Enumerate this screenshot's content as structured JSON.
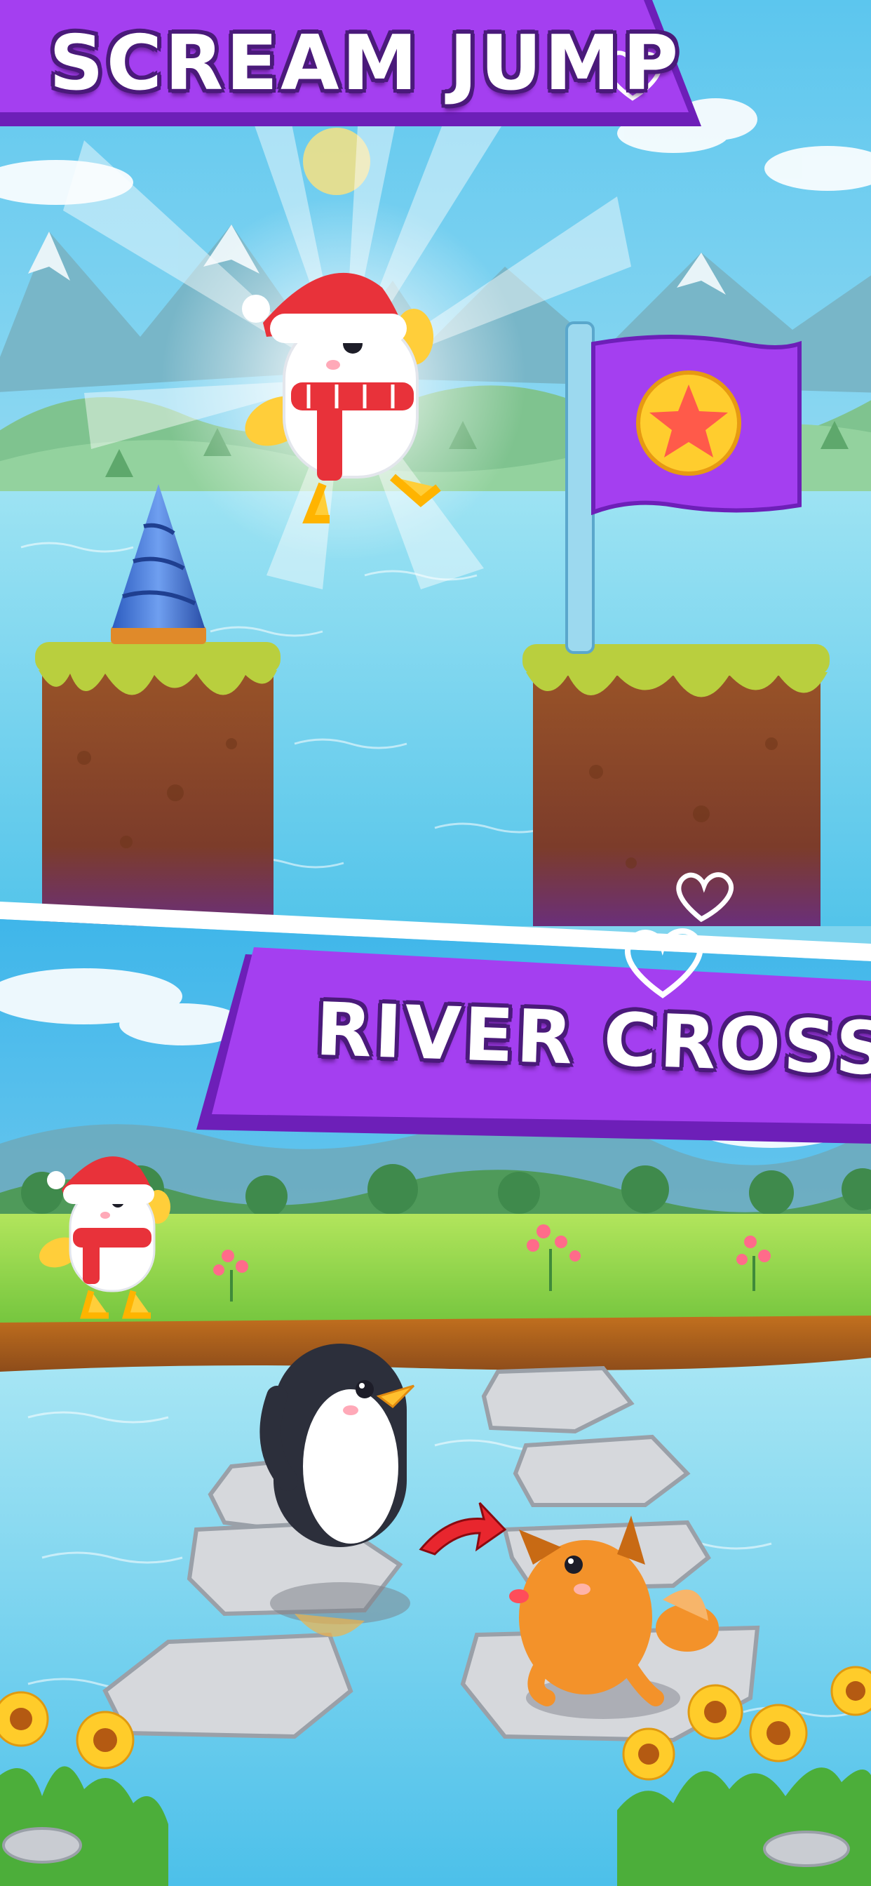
{
  "banners": {
    "top_title": "SCREAM JUMP",
    "bottom_title": "RIVER CROSS"
  },
  "colors": {
    "banner_purple": "#a43ff0",
    "banner_purple_dark": "#6d1fb8",
    "text_outline": "#4a1a7a",
    "sky_top": "#56c8f0",
    "water": "#6ed2ee",
    "grass_top": "#c2d94a",
    "dirt": "#8a4a22",
    "flag_purple": "#a43ff0",
    "star_yellow": "#ffcd2e",
    "star_red": "#ff5a4a",
    "penguin_black": "#2c2f3b",
    "dog_orange": "#f3922a",
    "meadow_green": "#8fd64a"
  },
  "icons": {
    "heart": "heart-outline-icon",
    "star": "star-icon",
    "arrow": "arrow-right-icon"
  }
}
